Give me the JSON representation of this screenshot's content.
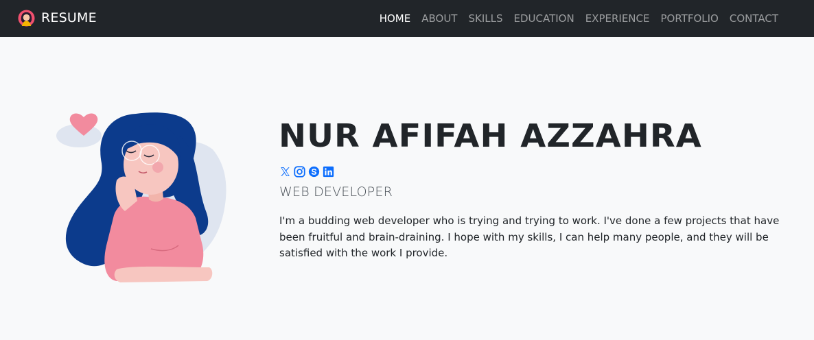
{
  "navbar": {
    "brand": "RESUME",
    "logo_icon": "avatar-logo-icon",
    "links": [
      {
        "label": "HOME",
        "active": true
      },
      {
        "label": "ABOUT",
        "active": false
      },
      {
        "label": "SKILLS",
        "active": false
      },
      {
        "label": "EDUCATION",
        "active": false
      },
      {
        "label": "EXPERIENCE",
        "active": false
      },
      {
        "label": "PORTFOLIO",
        "active": false
      },
      {
        "label": "CONTACT",
        "active": false
      }
    ]
  },
  "hero": {
    "name": "NUR AFIFAH AZZAHRA",
    "role": "WEB DEVELOPER",
    "bio": "I'm a budding web developer who is trying and trying to work. I've done a few projects that have been fruitful and brain-draining. I hope with my skills, I can help many people, and they will be satisfied with the work I provide.",
    "social": [
      {
        "icon": "x-twitter-icon"
      },
      {
        "icon": "instagram-icon"
      },
      {
        "icon": "skype-icon"
      },
      {
        "icon": "linkedin-icon"
      }
    ]
  },
  "colors": {
    "navbar_bg": "#212529",
    "page_bg": "#f8f9fa",
    "social_blue": "#0d6efd",
    "hair_blue": "#0c3b8c",
    "shirt_pink": "#f28b9e",
    "skin": "#f7c6c0"
  }
}
